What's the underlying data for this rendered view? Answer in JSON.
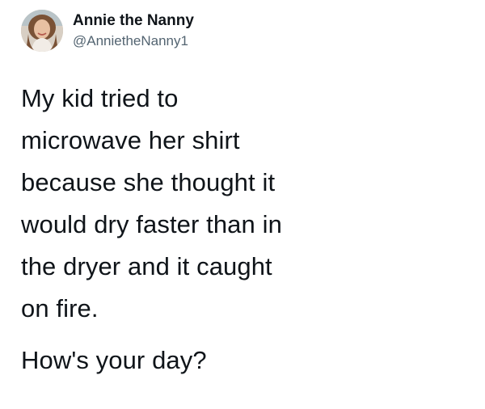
{
  "author": {
    "display_name": "Annie the Nanny",
    "handle": "@AnnietheNanny1",
    "avatar_icon": "profile-photo"
  },
  "tweet": {
    "lines": [
      "My kid tried to",
      "microwave her shirt",
      "because she thought it",
      "would dry faster than in",
      "the dryer and it caught",
      "on fire."
    ],
    "followup": "How's your day?"
  },
  "colors": {
    "text": "#0f1419",
    "secondary_text": "#536471",
    "background": "#ffffff"
  }
}
